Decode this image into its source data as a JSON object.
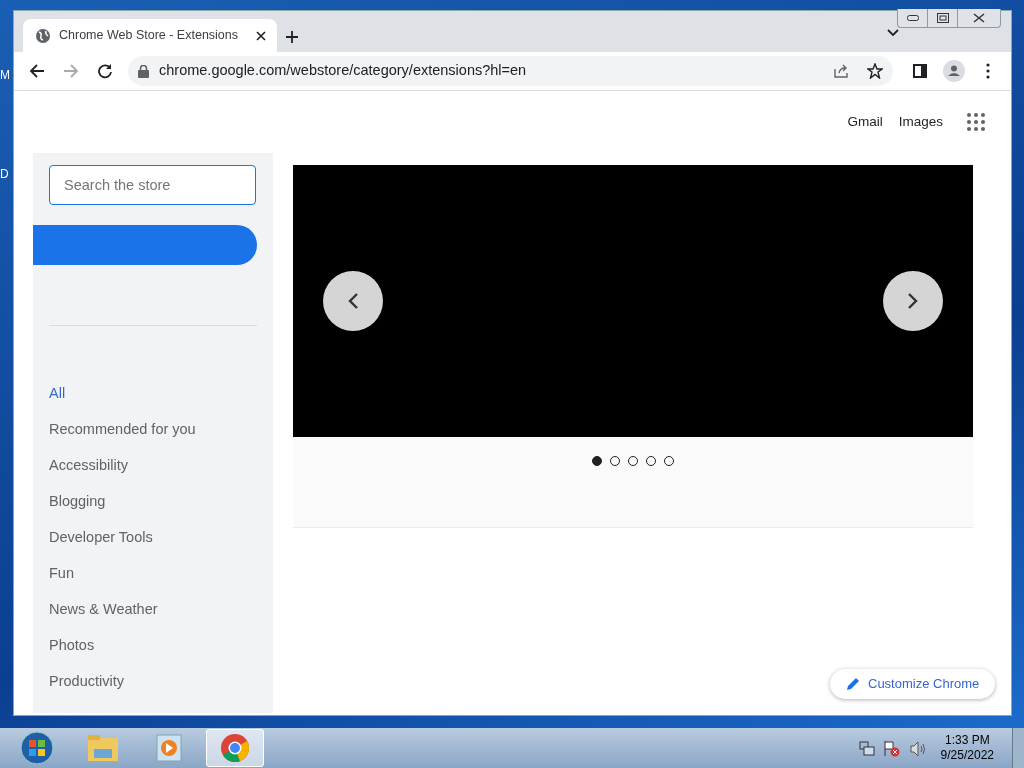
{
  "desktop": {
    "icon_labels": [
      "M",
      "D"
    ]
  },
  "browser": {
    "tab": {
      "title": "Chrome Web Store - Extensions",
      "selected": true
    },
    "url": "chrome.google.com/webstore/category/extensions?hl=en"
  },
  "header_links": [
    "Gmail",
    "Images"
  ],
  "search": {
    "placeholder": "Search the store"
  },
  "categories": [
    {
      "label": "All",
      "selected": true
    },
    {
      "label": "Recommended for you",
      "selected": false
    },
    {
      "label": "Accessibility",
      "selected": false
    },
    {
      "label": "Blogging",
      "selected": false
    },
    {
      "label": "Developer Tools",
      "selected": false
    },
    {
      "label": "Fun",
      "selected": false
    },
    {
      "label": "News & Weather",
      "selected": false
    },
    {
      "label": "Photos",
      "selected": false
    },
    {
      "label": "Productivity",
      "selected": false
    }
  ],
  "carousel": {
    "dots": [
      {
        "selected": true
      },
      {
        "selected": false
      },
      {
        "selected": false
      },
      {
        "selected": false
      },
      {
        "selected": false
      }
    ]
  },
  "customize_button": "Customize Chrome",
  "taskbar": {
    "apps": [
      {
        "kind": "folder",
        "active": false
      },
      {
        "kind": "media",
        "active": false
      },
      {
        "kind": "chrome",
        "active": true
      }
    ],
    "clock": {
      "time": "1:33 PM",
      "date": "9/25/2022"
    }
  }
}
